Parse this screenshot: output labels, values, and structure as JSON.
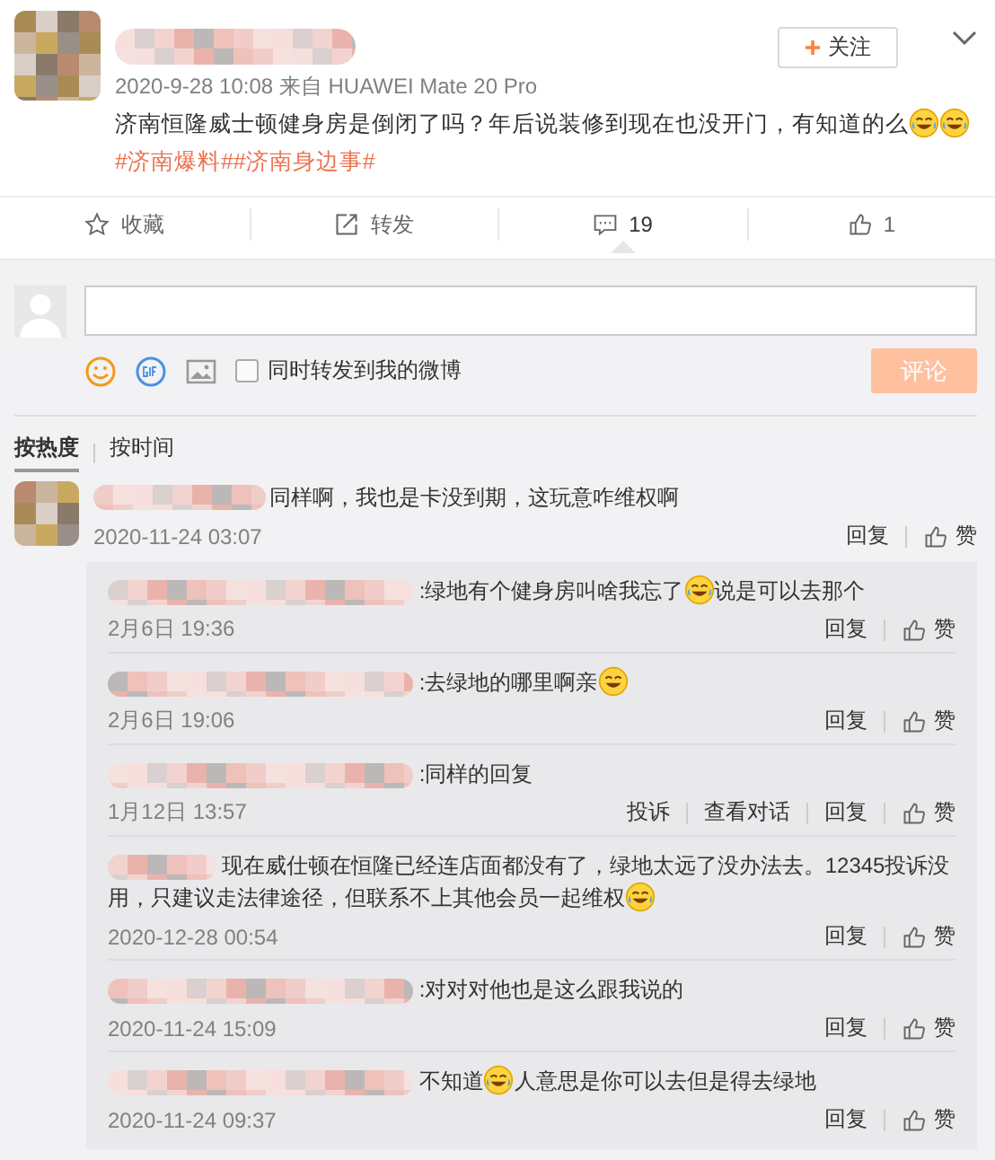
{
  "post": {
    "follow_button": "关注",
    "meta": "2020-9-28 10:08 来自 HUAWEI Mate 20 Pro",
    "content": [
      {
        "kind": "text",
        "text": "济南恒隆威士顿健身房是倒闭了吗？年后说装修到现在也没开门，有知道的么"
      },
      {
        "kind": "emoji"
      },
      {
        "kind": "emoji"
      },
      {
        "kind": "topic",
        "text": "#济南爆料#"
      },
      {
        "kind": "topic",
        "text": "#济南身边事#"
      }
    ]
  },
  "actions": [
    {
      "kind": "star",
      "label": "收藏",
      "selected": false
    },
    {
      "kind": "share",
      "label": "转发",
      "selected": false
    },
    {
      "kind": "comment",
      "label": "19",
      "selected": true
    },
    {
      "kind": "like",
      "label": "1",
      "selected": false
    }
  ],
  "composer": {
    "repost_label": "同时转发到我的微博",
    "repost_checked": false,
    "submit": "评论"
  },
  "sort_tabs": [
    {
      "label": "按热度",
      "selected": true
    },
    {
      "label": "按时间",
      "selected": false
    }
  ],
  "comment": {
    "content": [
      {
        "kind": "text",
        "text": "同样啊，我也是卡没到期，这玩意咋维权啊"
      }
    ],
    "date": "2020-11-24 03:07",
    "actions": [
      {
        "kind": "link",
        "label": "回复"
      },
      {
        "kind": "like",
        "label": "赞"
      }
    ]
  },
  "replies": [
    {
      "content": [
        {
          "kind": "text",
          "text": ":绿地有个健身房叫啥我忘了"
        },
        {
          "kind": "emoji"
        },
        {
          "kind": "text",
          "text": "说是可以去那个"
        }
      ],
      "date": "2月6日 19:36",
      "actions": [
        {
          "kind": "link",
          "label": "回复"
        },
        {
          "kind": "like",
          "label": "赞"
        }
      ]
    },
    {
      "content": [
        {
          "kind": "text",
          "text": ":去绿地的哪里啊亲"
        },
        {
          "kind": "laugh"
        }
      ],
      "date": "2月6日 19:06",
      "actions": [
        {
          "kind": "link",
          "label": "回复"
        },
        {
          "kind": "like",
          "label": "赞"
        }
      ]
    },
    {
      "content": [
        {
          "kind": "text",
          "text": ":同样的回复"
        }
      ],
      "date": "1月12日 13:57",
      "actions": [
        {
          "kind": "link",
          "label": "投诉"
        },
        {
          "kind": "link",
          "label": "查看对话"
        },
        {
          "kind": "link",
          "label": "回复"
        },
        {
          "kind": "like",
          "label": "赞"
        }
      ]
    },
    {
      "content": [
        {
          "kind": "text",
          "text": "现在威仕顿在恒隆已经连店面都没有了，绿地太远了没办法去。12345投诉没用，只建议走法律途径，但联系不上其他会员一起维权"
        },
        {
          "kind": "emoji"
        }
      ],
      "date": "2020-12-28 00:54",
      "actions": [
        {
          "kind": "link",
          "label": "回复"
        },
        {
          "kind": "like",
          "label": "赞"
        }
      ]
    },
    {
      "content": [
        {
          "kind": "text",
          "text": ":对对对他也是这么跟我说的"
        }
      ],
      "date": "2020-11-24 15:09",
      "actions": [
        {
          "kind": "link",
          "label": "回复"
        },
        {
          "kind": "like",
          "label": "赞"
        }
      ]
    },
    {
      "content": [
        {
          "kind": "text",
          "text": "不知道"
        },
        {
          "kind": "emoji"
        },
        {
          "kind": "text",
          "text": "人意思是你可以去但是得去绿地"
        }
      ],
      "date": "2020-11-24 09:37",
      "actions": [
        {
          "kind": "link",
          "label": "回复"
        },
        {
          "kind": "like",
          "label": "赞"
        }
      ]
    }
  ]
}
